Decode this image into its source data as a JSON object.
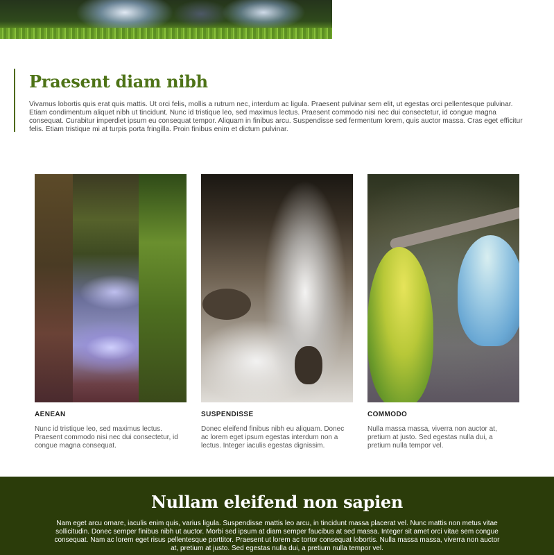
{
  "intro": {
    "title": "Praesent diam nibh",
    "body": "Vivamus lobortis quis erat quis mattis. Ut orci felis, mollis a rutrum nec, interdum ac ligula. Praesent pulvinar sem elit, ut egestas orci pellentesque pulvinar. Etiam condimentum aliquet nibh ut tincidunt. Nunc id tristique leo, sed maximus lectus. Praesent commodo nisi nec dui consectetur, id congue magna consequat. Curabitur imperdiet ipsum eu consequat tempor. Aliquam in finibus arcu. Suspendisse sed fermentum lorem, quis auctor massa. Cras eget efficitur felis. Etiam tristique mi at turpis porta fringilla. Proin finibus enim et dictum pulvinar."
  },
  "cards": [
    {
      "title": "AENEAN",
      "body": "Nunc id tristique leo, sed maximus lectus. Praesent commodo nisi nec dui consectetur, id congue magna consequat."
    },
    {
      "title": "SUSPENDISSE",
      "body": "Donec eleifend finibus nibh eu aliquam. Donec ac lorem eget ipsum egestas interdum non a lectus. Integer iaculis egestas dignissim."
    },
    {
      "title": "COMMODO",
      "body": "Nulla massa massa, viverra non auctor at, pretium at justo. Sed egestas nulla dui, a pretium nulla tempor vel."
    }
  ],
  "footer": {
    "title": "Nullam eleifend non sapien",
    "body": "Nam eget arcu ornare, iaculis enim quis, varius ligula. Suspendisse mattis leo arcu, in tincidunt massa placerat vel. Nunc mattis non metus vitae sollicitudin. Donec semper finibus nibh ut auctor. Morbi sed ipsum at diam semper faucibus at sed massa. Integer sit amet orci vitae sem congue consequat. Nam ac lorem eget risus pellentesque porttitor. Praesent ut lorem ac tortor consequat lobortis. Nulla massa massa, viverra non auctor at, pretium at justo. Sed egestas nulla dui, a pretium nulla tempor vel."
  },
  "colors": {
    "heading_green": "#4e7317",
    "accent_border": "#4e6a17",
    "footer_band": "#2b3c0a"
  }
}
